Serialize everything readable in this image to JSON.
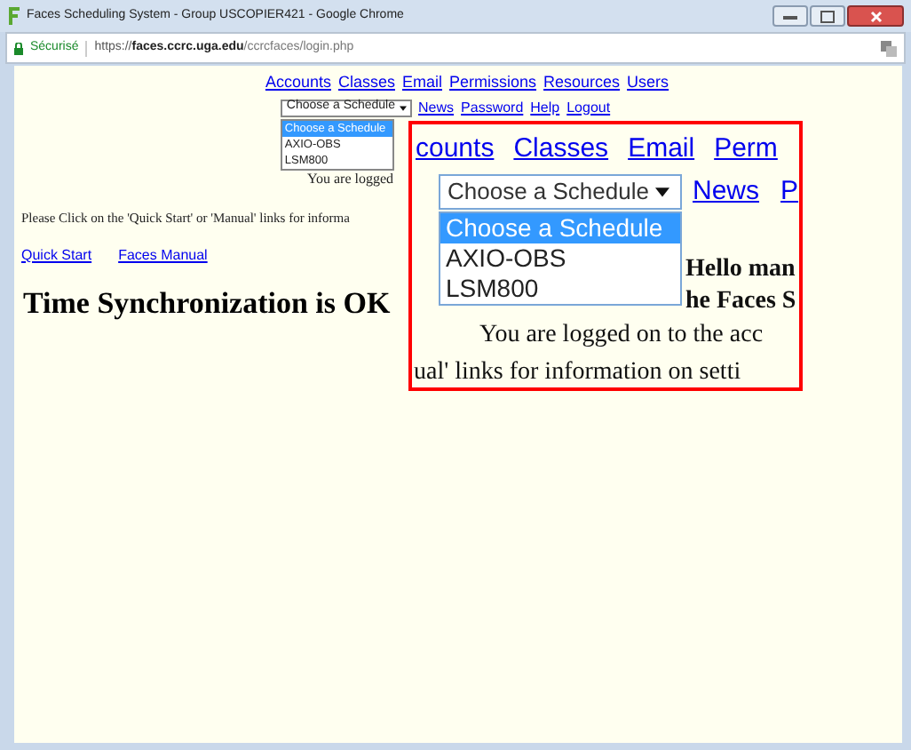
{
  "window": {
    "title": "Faces Scheduling System - Group USCOPIER421 - Google Chrome"
  },
  "address_bar": {
    "security_label": "Sécurisé",
    "url_host": "https://faces.ccrc.uga.edu",
    "url_path": "/ccrcfaces/login.php"
  },
  "nav": {
    "links": [
      "Accounts",
      "Classes",
      "Email",
      "Permissions",
      "Resources",
      "Users"
    ],
    "schedule_select": {
      "value": "Choose a Schedule",
      "options": [
        {
          "label": "Choose a Schedule",
          "selected": true
        },
        {
          "label": "AXIO-OBS",
          "selected": false
        },
        {
          "label": "LSM800",
          "selected": false
        }
      ]
    },
    "links2": [
      "News",
      "Password",
      "Help",
      "Logout"
    ]
  },
  "logged_text": "You are logged",
  "instructions": "Please Click on the 'Quick Start' or 'Manual' links for informa",
  "quick_links": [
    "Quick Start",
    "Faces Manual"
  ],
  "heading": "Time Synchronization is OK",
  "callout": {
    "nav_links": [
      "counts",
      "Classes",
      "Email",
      "Perm"
    ],
    "schedule_select": {
      "value": "Choose a Schedule",
      "options": [
        {
          "label": "Choose a Schedule",
          "selected": true
        },
        {
          "label": "AXIO-OBS",
          "selected": false
        },
        {
          "label": "LSM800",
          "selected": false
        }
      ]
    },
    "links2": [
      "News",
      "P"
    ],
    "lines": [
      {
        "text": "Hello man",
        "bold": true
      },
      {
        "text": "he Faces S",
        "bold": true
      },
      {
        "text": "You are logged on to the acc",
        "bold": false
      },
      {
        "text": "ual' links for information on setti",
        "bold": false
      }
    ]
  }
}
